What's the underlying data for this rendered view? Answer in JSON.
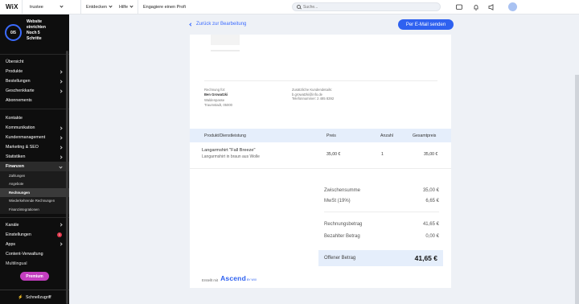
{
  "topbar": {
    "logo": "WiX",
    "site_name": "trustee",
    "menu": [
      "Entdecken",
      "Hilfe"
    ],
    "hire_link": "Engagiere einen Profi",
    "search_placeholder": "Suche..."
  },
  "sidebar": {
    "progress": "0/5",
    "setup_title": "Website einrichten",
    "setup_remaining": "Noch 5 Schritte",
    "items_top": [
      "Übersicht",
      "Produkte",
      "Bestellungen",
      "Geschenkkarte",
      "Abonnements"
    ],
    "items_mid": [
      "Kontakte",
      "Kommunikation",
      "Kundenmanagement",
      "Marketing & SEO",
      "Statistiken"
    ],
    "finance_label": "Finanzen",
    "finance_sub": [
      "Zahlungen",
      "Angebote",
      "Rechnungen",
      "Wiederkehrende Rechnungen",
      "Finanzintegrationen"
    ],
    "selected_sub": "Rechnungen",
    "items_bottom": [
      "Kanäle",
      "Einstellungen",
      "Apps",
      "Content-Verwaltung",
      "Multilingual"
    ],
    "settings_badge": "1",
    "premium_label": "Premium",
    "quick_access": "Schnellzugriff"
  },
  "main": {
    "back_link": "Zurück zur Bearbeitung",
    "email_button": "Per E-Mail senden"
  },
  "invoice": {
    "bill_to_label": "Rechnung für:",
    "bill_to_name": "Ben Growatzki",
    "bill_to_street": "Waldenpasse",
    "bill_to_city": "Traumstadt, 05000",
    "extra_label": "Zusätzliche Kundendetails:",
    "extra_email": "b.growatzki@info.de",
    "extra_phone": "Telefonnummer: 2 485 8392",
    "columns": [
      "Produkt/Dienstleistung",
      "Preis",
      "Anzahl",
      "Gesamtpreis"
    ],
    "item": {
      "name": "Langarmshirt \"Fall Breeze\"",
      "description": "Langarmshirt in braun aus Wolle",
      "price": "35,00 €",
      "qty": "1",
      "total": "35,00 €"
    },
    "subtotal_label": "Zwischensumme",
    "subtotal": "35,00 €",
    "vat_label": "MwSt (19%)",
    "vat": "6,65 €",
    "invoice_amount_label": "Rechnungsbetrag",
    "invoice_amount": "41,65 €",
    "paid_label": "Bezahlter Betrag",
    "paid": "0,00 €",
    "open_label": "Offener Betrag",
    "open": "41,65 €",
    "created_with": "Erstellt mit",
    "brand": "Ascend",
    "brand_suffix": "BY WIX"
  },
  "colors": {
    "accent": "#2e61f0",
    "premium": "#c43ec0",
    "sidebar_bg": "#0e0e0e",
    "table_header_bg": "#e5eefb"
  }
}
